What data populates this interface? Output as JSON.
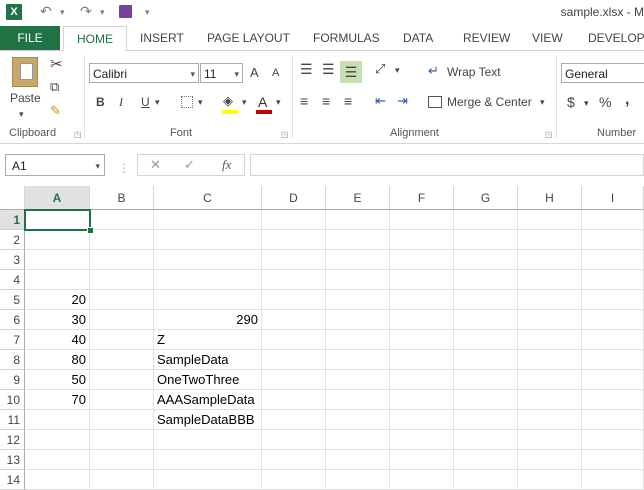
{
  "titlebar": {
    "title": "sample.xlsx - M",
    "app_icon": "X"
  },
  "tabs": [
    "FILE",
    "HOME",
    "INSERT",
    "PAGE LAYOUT",
    "FORMULAS",
    "DATA",
    "REVIEW",
    "VIEW",
    "DEVELOPE"
  ],
  "ribbon": {
    "clipboard": {
      "paste_label": "Paste",
      "group_label": "Clipboard"
    },
    "font": {
      "font_name": "Calibri",
      "font_size": "11",
      "grow": "A",
      "shrink": "A",
      "bold": "B",
      "italic": "I",
      "underline": "U",
      "group_label": "Font"
    },
    "alignment": {
      "wrap_text": "Wrap Text",
      "merge_center": "Merge & Center",
      "group_label": "Alignment"
    },
    "number": {
      "format": "General",
      "currency": "$",
      "percent": "%",
      "comma": ",",
      "group_label": "Number"
    }
  },
  "formula_bar": {
    "name_box": "A1",
    "cancel": "✕",
    "enter": "✓",
    "fx": "fx",
    "formula": ""
  },
  "sheet": {
    "columns": [
      "A",
      "B",
      "C",
      "D",
      "E",
      "F",
      "G",
      "H",
      "I"
    ],
    "rows": [
      "1",
      "2",
      "3",
      "4",
      "5",
      "6",
      "7",
      "8",
      "9",
      "10",
      "11",
      "12",
      "13",
      "14"
    ],
    "cells": {
      "A5": "20",
      "A6": "30",
      "A7": "40",
      "A8": "80",
      "A9": "50",
      "A10": "70",
      "C6": "290",
      "C7": "Z",
      "C8": "SampleData",
      "C9": "OneTwoThree",
      "C10": "AAASampleData",
      "C11": "SampleDataBBB"
    },
    "selected_cell": "A1"
  }
}
